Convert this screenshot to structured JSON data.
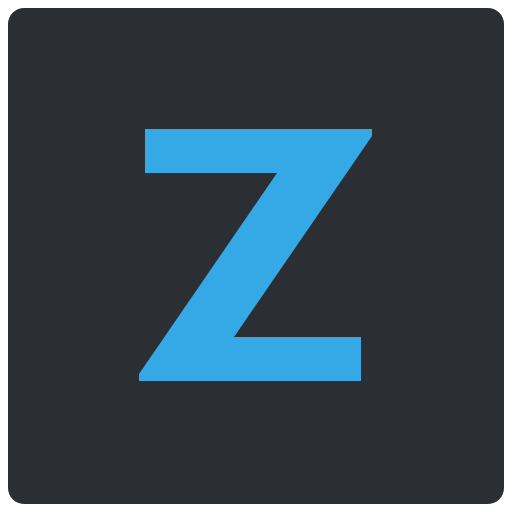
{
  "app_icon": {
    "logo_text": "Z",
    "icon_name": "z-letter-logo-icon",
    "colors": {
      "tile_background": "#2b2f33",
      "logo_fill": "#35a9e6",
      "page_background": "#ffffff"
    }
  }
}
